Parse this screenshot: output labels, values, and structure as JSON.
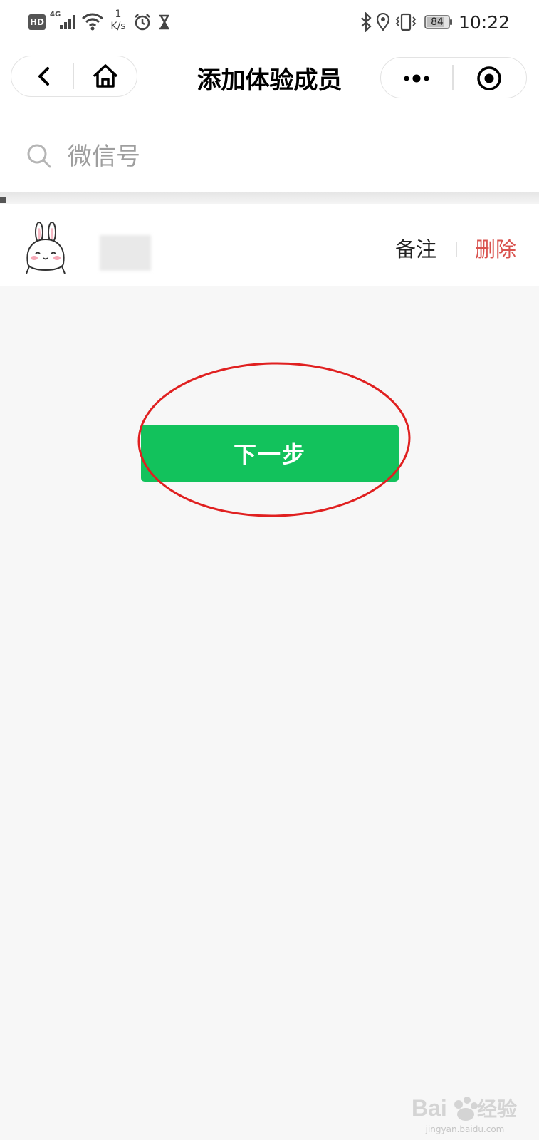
{
  "status_bar": {
    "hd": "HD",
    "network": "4G",
    "speed_value": "1",
    "speed_unit": "K/s",
    "battery": "84",
    "time": "10:22"
  },
  "nav": {
    "title": "添加体验成员"
  },
  "search": {
    "placeholder": "微信号",
    "value": ""
  },
  "member": {
    "remark_label": "备注",
    "delete_label": "删除"
  },
  "actions": {
    "next_label": "下一步"
  },
  "watermark": {
    "text": "jingyan.baidu.com"
  },
  "colors": {
    "primary_green": "#12c25c",
    "delete_red": "#d9534f",
    "annotation_red": "#e02020",
    "background": "#f7f7f7"
  }
}
